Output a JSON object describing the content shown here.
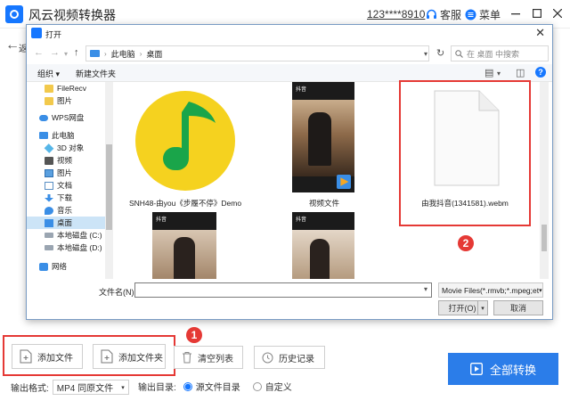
{
  "app": {
    "title": "风云视频转换器",
    "account": "123****8910",
    "service_label": "客服",
    "menu_label": "菜单",
    "back_label": "返"
  },
  "toolbar": {
    "add_file": "添加文件",
    "add_folder": "添加文件夹",
    "clear_list": "清空列表",
    "history": "历史记录",
    "convert_all": "全部转换",
    "badge_1": "1",
    "badge_2": "2"
  },
  "output": {
    "format_label": "输出格式:",
    "format_value": "MP4 同原文件",
    "dir_label": "输出目录:",
    "option_source": "源文件目录",
    "option_custom": "自定义",
    "selected_option": "源文件目录"
  },
  "dialog": {
    "title": "打开",
    "breadcrumb": [
      "此电脑",
      "桌面"
    ],
    "search_placeholder": "在 桌面 中搜索",
    "organize": "组织 ▾",
    "new_folder": "新建文件夹",
    "nav_items": [
      {
        "label": "FileRecv",
        "icon": "folder-icon"
      },
      {
        "label": "图片",
        "icon": "folder-icon"
      },
      {
        "label": "WPS网盘",
        "icon": "cloud-icon"
      },
      {
        "label": "此电脑",
        "icon": "computer-icon"
      },
      {
        "label": "3D 对象",
        "icon": "3d-objects-icon"
      },
      {
        "label": "视频",
        "icon": "video-icon"
      },
      {
        "label": "图片",
        "icon": "picture-icon"
      },
      {
        "label": "文档",
        "icon": "document-icon"
      },
      {
        "label": "下载",
        "icon": "download-icon"
      },
      {
        "label": "音乐",
        "icon": "music-icon"
      },
      {
        "label": "桌面",
        "icon": "desktop-icon",
        "selected": true
      },
      {
        "label": "本地磁盘 (C:)",
        "icon": "drive-icon"
      },
      {
        "label": "本地磁盘 (D:)",
        "icon": "drive-icon"
      },
      {
        "label": "网络",
        "icon": "network-icon"
      }
    ],
    "files": [
      {
        "label": "SNH48-由you《步履不停》Demo",
        "kind": "music-app-icon"
      },
      {
        "label": "视频文件",
        "kind": "video-thumbnail"
      },
      {
        "label": "由我抖音(1341581).webm",
        "kind": "blank-document"
      }
    ],
    "thumb_tag": "抖音",
    "file_name_label": "文件名(N):",
    "file_name_value": "",
    "file_type": "Movie Files(*.rmvb;*.mpeg;et",
    "open_button": "打开(O)",
    "cancel_button": "取消"
  },
  "colors": {
    "accent": "#2b7de9",
    "highlight": "#e53935",
    "music_bg": "#f5d21f",
    "music_note": "#1aa54a"
  }
}
